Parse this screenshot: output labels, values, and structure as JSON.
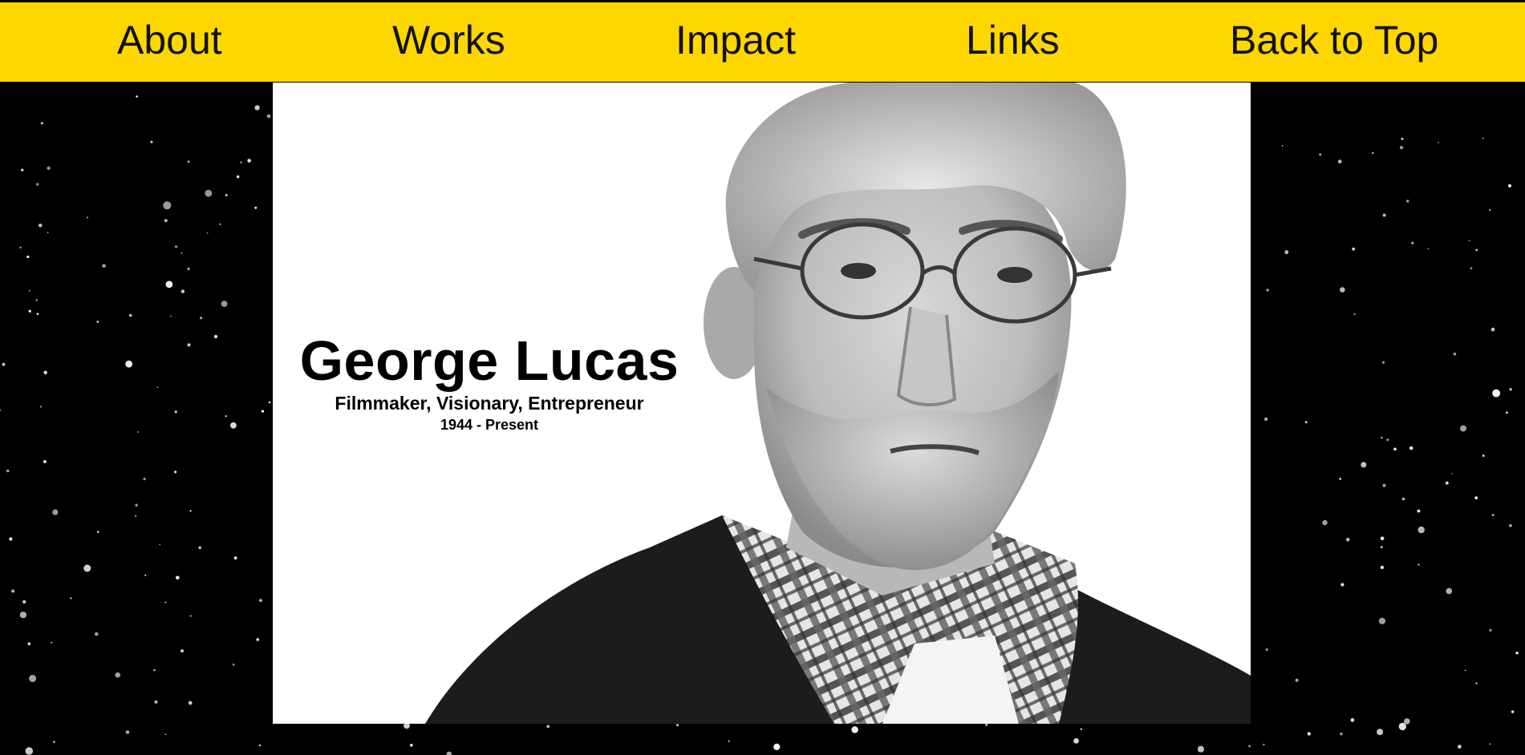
{
  "nav": {
    "items": [
      {
        "label": "About"
      },
      {
        "label": "Works"
      },
      {
        "label": "Impact"
      },
      {
        "label": "Links"
      },
      {
        "label": "Back to Top"
      }
    ]
  },
  "hero": {
    "name": "George Lucas",
    "tagline": "Filmmaker, Visionary, Entrepreneur",
    "dates": "1944 - Present"
  },
  "colors": {
    "nav_background": "#ffd700",
    "page_background": "#000000",
    "hero_background": "#ffffff"
  }
}
